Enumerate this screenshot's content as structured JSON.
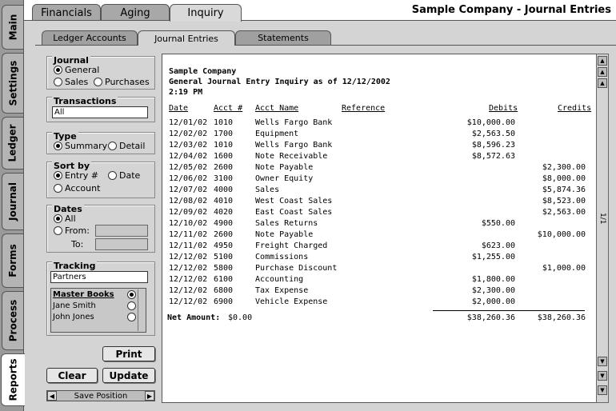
{
  "app_title": "Sample Company - Journal Entries",
  "side_tabs": [
    "Main",
    "Settings",
    "Ledger",
    "Journal",
    "Forms",
    "Process",
    "Reports"
  ],
  "top_tabs": [
    "Financials",
    "Aging",
    "Inquiry"
  ],
  "sub_tabs": [
    "Ledger Accounts",
    "Journal Entries",
    "Statements"
  ],
  "journal": {
    "label": "Journal",
    "options": [
      "General",
      "Sales",
      "Purchases"
    ],
    "selected": "General"
  },
  "transactions": {
    "label": "Transactions",
    "value": "All"
  },
  "type": {
    "label": "Type",
    "options": [
      "Summary",
      "Detail"
    ],
    "selected": "Summary"
  },
  "sort_by": {
    "label": "Sort by",
    "options": [
      "Entry #",
      "Date",
      "Account"
    ],
    "selected": "Entry #"
  },
  "dates": {
    "label": "Dates",
    "all": "All",
    "from": "From:",
    "to": "To:",
    "from_value": "",
    "to_value": ""
  },
  "tracking": {
    "label": "Tracking",
    "value": "Partners",
    "header": "Master Books",
    "items": [
      "Jane Smith",
      "John Jones"
    ]
  },
  "buttons": {
    "print": "Print",
    "clear": "Clear",
    "update": "Update",
    "save_position": "Save Position"
  },
  "report": {
    "company": "Sample Company",
    "title": "General Journal Entry Inquiry as of 12/12/2002",
    "time": "2:19 PM",
    "columns": [
      "Date",
      "Acct #",
      "Acct Name",
      "Reference",
      "Debits",
      "Credits"
    ],
    "rows": [
      {
        "date": "12/01/02",
        "acct": "1010",
        "name": "Wells Fargo Bank",
        "ref": "",
        "debit": "$10,000.00",
        "credit": ""
      },
      {
        "date": "12/02/02",
        "acct": "1700",
        "name": "Equipment",
        "ref": "",
        "debit": "$2,563.50",
        "credit": ""
      },
      {
        "date": "12/03/02",
        "acct": "1010",
        "name": "Wells Fargo Bank",
        "ref": "",
        "debit": "$8,596.23",
        "credit": ""
      },
      {
        "date": "12/04/02",
        "acct": "1600",
        "name": "Note Receivable",
        "ref": "",
        "debit": "$8,572.63",
        "credit": ""
      },
      {
        "date": "12/05/02",
        "acct": "2600",
        "name": "Note Payable",
        "ref": "",
        "debit": "",
        "credit": "$2,300.00"
      },
      {
        "date": "12/06/02",
        "acct": "3100",
        "name": "Owner Equity",
        "ref": "",
        "debit": "",
        "credit": "$8,000.00"
      },
      {
        "date": "12/07/02",
        "acct": "4000",
        "name": "Sales",
        "ref": "",
        "debit": "",
        "credit": "$5,874.36"
      },
      {
        "date": "12/08/02",
        "acct": "4010",
        "name": "West Coast Sales",
        "ref": "",
        "debit": "",
        "credit": "$8,523.00"
      },
      {
        "date": "12/09/02",
        "acct": "4020",
        "name": "East Coast Sales",
        "ref": "",
        "debit": "",
        "credit": "$2,563.00"
      },
      {
        "date": "12/10/02",
        "acct": "4900",
        "name": "Sales Returns",
        "ref": "",
        "debit": "$550.00",
        "credit": ""
      },
      {
        "date": "12/11/02",
        "acct": "2600",
        "name": "Note Payable",
        "ref": "",
        "debit": "",
        "credit": "$10,000.00"
      },
      {
        "date": "12/11/02",
        "acct": "4950",
        "name": "Freight Charged",
        "ref": "",
        "debit": "$623.00",
        "credit": ""
      },
      {
        "date": "12/12/02",
        "acct": "5100",
        "name": "Commissions",
        "ref": "",
        "debit": "$1,255.00",
        "credit": ""
      },
      {
        "date": "12/12/02",
        "acct": "5800",
        "name": "Purchase Discount",
        "ref": "",
        "debit": "",
        "credit": "$1,000.00"
      },
      {
        "date": "12/12/02",
        "acct": "6100",
        "name": "Accounting",
        "ref": "",
        "debit": "$1,800.00",
        "credit": ""
      },
      {
        "date": "12/12/02",
        "acct": "6800",
        "name": "Tax Expense",
        "ref": "",
        "debit": "$2,300.00",
        "credit": ""
      },
      {
        "date": "12/12/02",
        "acct": "6900",
        "name": "Vehicle Expense",
        "ref": "",
        "debit": "$2,000.00",
        "credit": ""
      }
    ],
    "net_label": "Net Amount:",
    "net_value": "$0.00",
    "total_debits": "$38,260.36",
    "total_credits": "$38,260.36"
  },
  "scroll": {
    "page_indicator": "1/1"
  }
}
